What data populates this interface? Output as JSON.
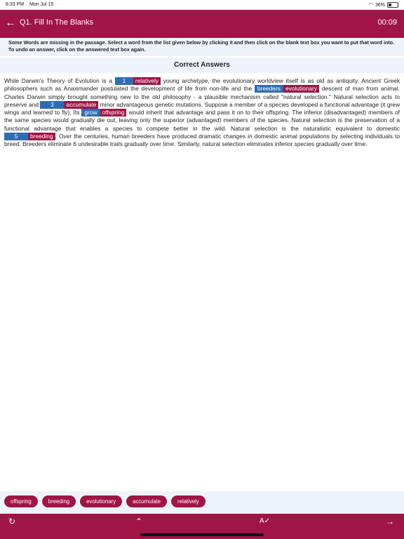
{
  "status": {
    "time": "8:33 PM",
    "date": "Mon Jul 15",
    "battery": "36%"
  },
  "header": {
    "title": "Q1. Fill In The Blanks",
    "timer": "00:09"
  },
  "instructions": "Some Words are missing in the passage. Select a word from the list given below by clicking it and then click on the blank text box you want to put that word into. To undo an answer, click on the answered text box again.",
  "correct_answers_heading": "Correct Answers",
  "passage": {
    "p1": "While Darwin's Theory of Evolution is a",
    "b1_user": "1",
    "b1_ans": "relatively",
    "p2": "young archetype, the evolutionary worldview itself is as old as antiquity. Ancient Greek philosophers such as Anaximander postulated the development of life from non-life and the",
    "b2_user": "breeders",
    "b2_ans": "evolutionary",
    "p3": "descent of man from animal. Charles Darwin simply brought something new to the old philosophy - a plausible mechanism called \"natural selection.\" Natural selection acts to preserve and",
    "b3_user": "3",
    "b3_ans": "accumulate",
    "p4": "minor advantageous genetic mutations. Suppose a member of a species developed a functional advantage (it grew wings and learned to fly). Its",
    "b4_user": "grow",
    "b4_ans": "offspring",
    "p5": "would inherit that advantage and pass it on to their offspring. The inferior (disadvantaged) members of the same species would gradually die out, leaving only the superior (advantaged) members of the species. Natural selection is the preservation of a functional advantage that enables a species to compete better in the wild. Natural selection is the naturalistic equivalent to domestic",
    "b5_user": "5",
    "b5_ans": "breeding",
    "p6": ". Over the centuries, human breeders have produced dramatic changes in domestic animal populations by selecting individuals to breed. Breeders eliminate 6 undesirable traits gradually over time. Similarly, natural selection eliminates inferior species gradually over time."
  },
  "word_bank": [
    "offspring",
    "breeding",
    "evolutionary",
    "accumulate",
    "relatively"
  ],
  "toolbar": {
    "refresh_icon": "↻",
    "up_icon": "⌃",
    "spellcheck_icon": "A✓",
    "next_icon": "→"
  },
  "colors": {
    "primary": "#a01446",
    "user_blank": "#2f6db3",
    "panel": "#eef3fb"
  }
}
